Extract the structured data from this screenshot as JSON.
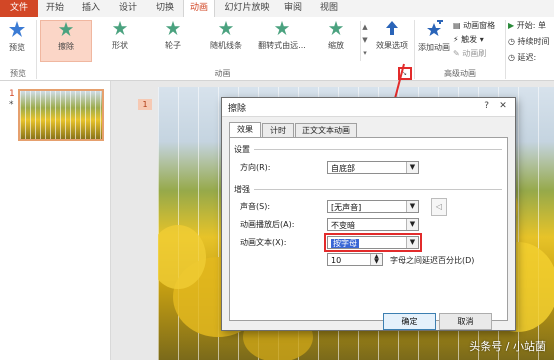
{
  "tabs": [
    "文件",
    "开始",
    "插入",
    "设计",
    "切换",
    "动画",
    "幻灯片放映",
    "审阅",
    "视图"
  ],
  "ribbon": {
    "preview": "预览",
    "preview_group": "预览",
    "animations": [
      "擦除",
      "形状",
      "轮子",
      "随机线条",
      "翻转式由远...",
      "缩放"
    ],
    "animation_group": "动画",
    "effect_options": "效果选项",
    "add_animation": "添加动画",
    "anim_pane": "动画窗格",
    "trigger": "触发",
    "anim_painter": "动画刷",
    "adv_group": "高级动画",
    "start": "开始: 单",
    "duration": "持续时间",
    "delay": "延迟:"
  },
  "slide_pane": {
    "num": "1",
    "star": "*"
  },
  "canvas": {
    "marker": "1"
  },
  "dialog": {
    "title": "擦除",
    "close": "?",
    "tabs": [
      "效果",
      "计时",
      "正文文本动画"
    ],
    "settings_header": "设置",
    "direction_label": "方向(R):",
    "direction_value": "自底部",
    "enhance_header": "增强",
    "sound_label": "声音(S):",
    "sound_value": "[无声音]",
    "after_label": "动画播放后(A):",
    "after_value": "不变暗",
    "text_label": "动画文本(X):",
    "text_value": "按字母",
    "delay_value": "10",
    "delay_suffix": "字母之间延迟百分比(D)",
    "ok": "确定",
    "cancel": "取消"
  },
  "watermark": "头条号 / 小站菌",
  "colors": {
    "accent": "#d24726",
    "highlight": "#e22b2b",
    "selection": "#3a67d6"
  }
}
